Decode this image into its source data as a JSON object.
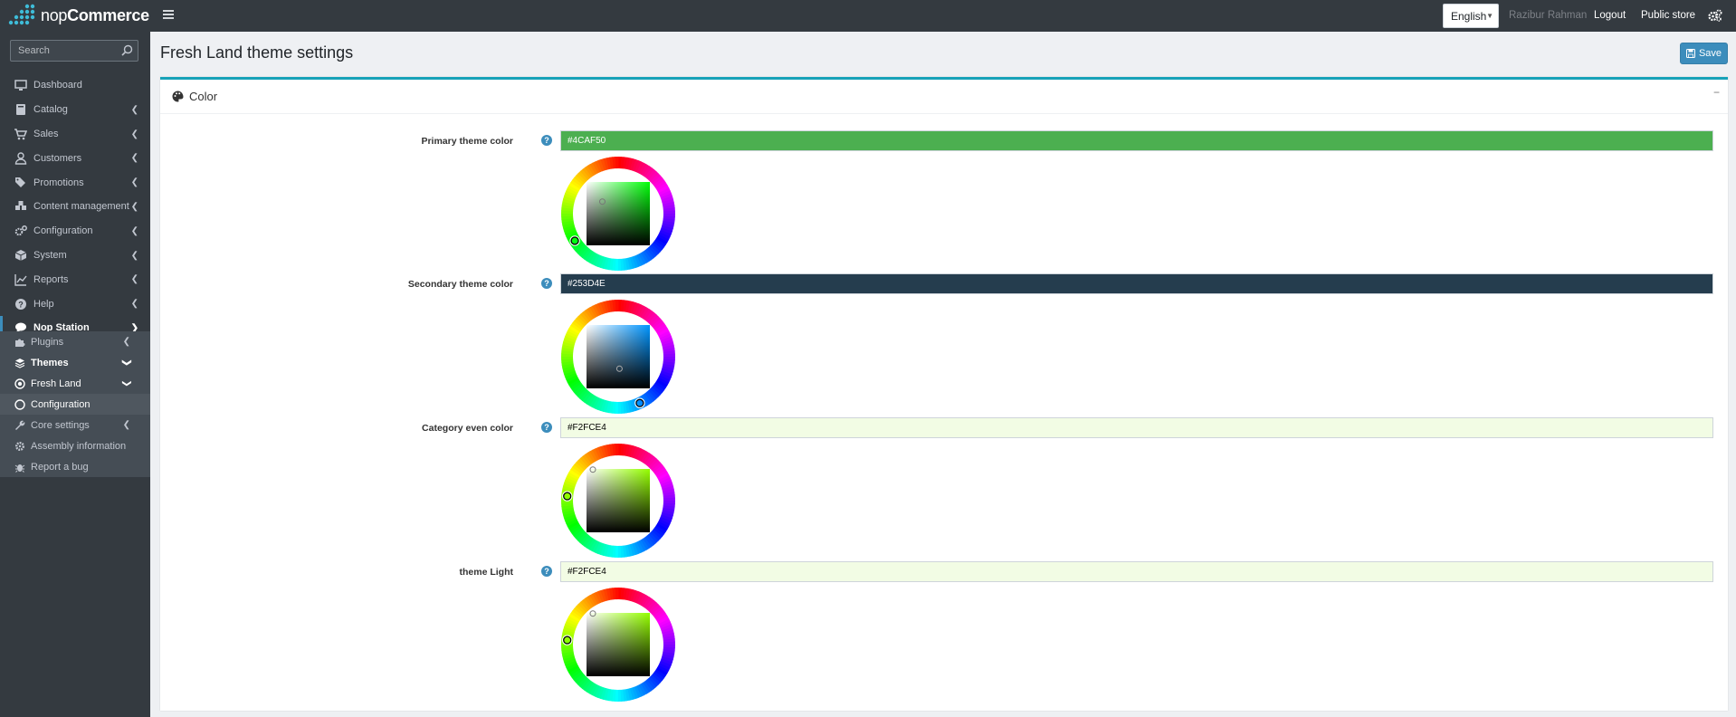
{
  "header": {
    "logo_nop": "nop",
    "logo_commerce": "Commerce",
    "language": "English",
    "user_name": "Razibur Rahman",
    "logout": "Logout",
    "public_store": "Public store"
  },
  "sidebar": {
    "search_placeholder": "Search",
    "items": [
      {
        "label": "Dashboard",
        "icon": "monitor-icon"
      },
      {
        "label": "Catalog",
        "icon": "book-icon"
      },
      {
        "label": "Sales",
        "icon": "cart-icon"
      },
      {
        "label": "Customers",
        "icon": "user-icon"
      },
      {
        "label": "Promotions",
        "icon": "tags-icon"
      },
      {
        "label": "Content management",
        "icon": "cubes-icon"
      },
      {
        "label": "Configuration",
        "icon": "gears-icon"
      },
      {
        "label": "System",
        "icon": "cube-icon"
      },
      {
        "label": "Reports",
        "icon": "chart-icon"
      },
      {
        "label": "Help",
        "icon": "question-icon"
      },
      {
        "label": "Nop Station",
        "icon": "speech-icon"
      }
    ],
    "sub_items": [
      {
        "label": "Plugins",
        "icon": "puzzle-icon"
      },
      {
        "label": "Themes",
        "icon": "layers-icon"
      },
      {
        "label": "Fresh Land",
        "icon": "dot-circle-icon"
      },
      {
        "label": "Configuration",
        "icon": "circle-icon"
      },
      {
        "label": "Core settings",
        "icon": "wrench-icon"
      },
      {
        "label": "Assembly information",
        "icon": "gear-icon"
      },
      {
        "label": "Report a bug",
        "icon": "bug-icon"
      }
    ]
  },
  "page": {
    "title": "Fresh Land theme settings",
    "save_label": "Save",
    "card_title": "Color",
    "collapse": "−"
  },
  "settings": [
    {
      "label": "Primary theme color",
      "value": "#4CAF50",
      "bg": "#4CAF50",
      "text_color": "#ffffff"
    },
    {
      "label": "Secondary theme color",
      "value": "#253D4E",
      "bg": "#253D4E",
      "text_color": "#ffffff"
    },
    {
      "label": "Category even color",
      "value": "#F2FCE4",
      "bg": "#F2FCE4",
      "text_color": "#000000"
    },
    {
      "label": "theme Light",
      "value": "#F2FCE4",
      "bg": "#F2FCE4",
      "text_color": "#000000"
    }
  ],
  "colors": {
    "header_bg": "#343a40",
    "accent": "#3c8dbc",
    "card_border": "#17a2b8"
  }
}
